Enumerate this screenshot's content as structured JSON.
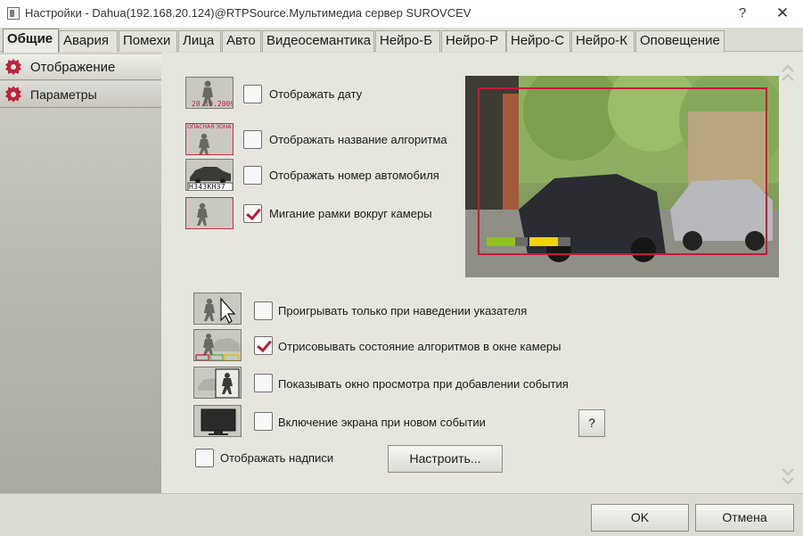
{
  "window": {
    "title": "Настройки - Dahua(192.168.20.124)@RTPSource.Мультимедиа сервер SUROVCEV",
    "help_glyph": "?",
    "close_glyph": "✕"
  },
  "tabs": [
    {
      "label": "Общие",
      "active": true
    },
    {
      "label": "Авария"
    },
    {
      "label": "Помехи"
    },
    {
      "label": "Лица"
    },
    {
      "label": "Авто"
    },
    {
      "label": "Видеосемантика"
    },
    {
      "label": "Нейро-Б"
    },
    {
      "label": "Нейро-Р"
    },
    {
      "label": "Нейро-С"
    },
    {
      "label": "Нейро-К"
    },
    {
      "label": "Оповещение"
    }
  ],
  "sidebar": {
    "items": [
      {
        "label": "Отображение",
        "icon": "gear-icon",
        "active": true
      },
      {
        "label": "Параметры",
        "icon": "gear-icon"
      }
    ]
  },
  "options_top": [
    {
      "label": "Отображать дату",
      "checked": false,
      "icon_text": "20.10.2009"
    },
    {
      "label": "Отображать название алгоритма",
      "checked": false,
      "icon_text": "ОПАСНАЯ ЗОНА"
    },
    {
      "label": "Отображать номер автомобиля",
      "checked": false,
      "icon_text": "Н343КН37"
    },
    {
      "label": "Мигание рамки вокруг камеры",
      "checked": true
    }
  ],
  "options_bottom": [
    {
      "label": "Проигрывать только при наведении указателя",
      "checked": false
    },
    {
      "label": "Отрисовывать состояние алгоритмов в окне камеры",
      "checked": true
    },
    {
      "label": "Показывать окно просмотра при добавлении события",
      "checked": false
    },
    {
      "label": "Включение экрана при новом событии",
      "checked": false
    }
  ],
  "show_labels": {
    "label": "Отображать надписи",
    "checked": false
  },
  "buttons": {
    "configure": "Настроить...",
    "question": "?",
    "ok": "OK",
    "cancel": "Отмена"
  },
  "colors": {
    "accent": "#b9273b",
    "frame": "#c8183a",
    "bar_green": "#8fc31f",
    "bar_yellow": "#f2d200"
  }
}
